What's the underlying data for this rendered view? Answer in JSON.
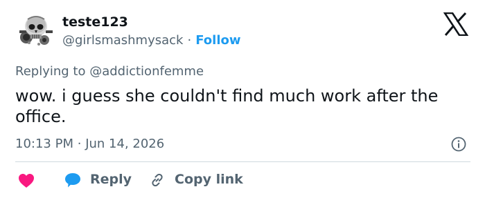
{
  "author": {
    "display_name": "teste123",
    "handle": "@girlsmashmysack",
    "separator": "·",
    "follow_label": "Follow",
    "avatar_icon": "skull-avatar-icon"
  },
  "brand": {
    "logo_icon": "x-logo-icon"
  },
  "tweet": {
    "replying_prefix": "Replying to",
    "replying_to": "@addictionfemme",
    "text": "wow. i guess she couldn't find much work after the office.",
    "time": "10:13 PM",
    "separator": "·",
    "date": "Jun 14, 2026"
  },
  "actions": {
    "like_icon": "heart-icon",
    "reply_icon": "speech-bubble-icon",
    "reply_label": "Reply",
    "copy_icon": "link-icon",
    "copy_label": "Copy link",
    "info_icon": "info-icon"
  },
  "colors": {
    "text": "#0f1419",
    "muted": "#536471",
    "accent": "#1d9bf0",
    "like": "#f91880",
    "divider": "#cfd9de"
  }
}
